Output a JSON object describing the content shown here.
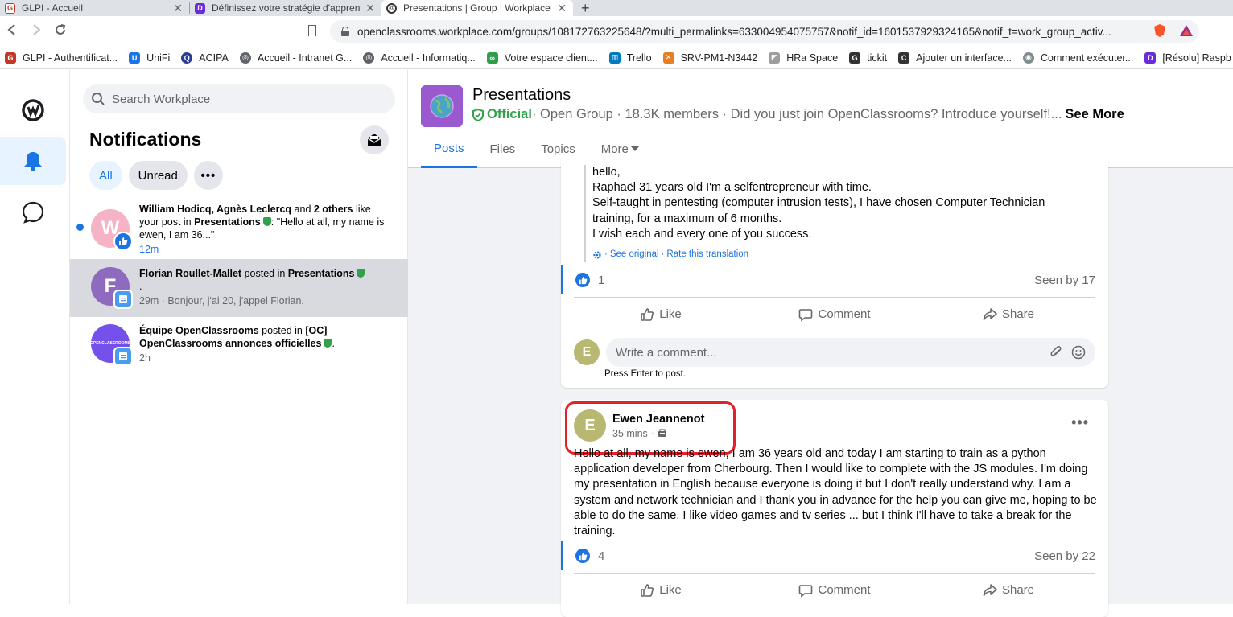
{
  "browser": {
    "tabs": [
      {
        "title": "GLPI - Accueil",
        "active": false
      },
      {
        "title": "Définissez votre stratégie d'apprentissage",
        "active": false
      },
      {
        "title": "Presentations | Group | Workplace",
        "active": true
      }
    ],
    "url": "openclassrooms.workplace.com/groups/108172763225648/?multi_permalinks=633004954075757&notif_id=1601537929324165&notif_t=work_group_activ...",
    "bookmarks": [
      {
        "label": "GLPI - Authentificat...",
        "color": "#c0392b",
        "icon": "G"
      },
      {
        "label": "UniFi",
        "color": "#1a73e8",
        "icon": "U"
      },
      {
        "label": "ACIPA",
        "color": "#2c3e8f",
        "icon": "Q"
      },
      {
        "label": "Accueil - Intranet G...",
        "color": "#5f6368",
        "icon": "◎"
      },
      {
        "label": "Accueil - Informatiq...",
        "color": "#5f6368",
        "icon": "◎"
      },
      {
        "label": "Votre espace client...",
        "color": "#2e9e4a",
        "icon": "∞"
      },
      {
        "label": "Trello",
        "color": "#0079bf",
        "icon": "▥"
      },
      {
        "label": "SRV-PM1-N3442",
        "color": "#e67e22",
        "icon": "✕"
      },
      {
        "label": "HRa Space",
        "color": "#9e9e9e",
        "icon": "◩"
      },
      {
        "label": "tickit",
        "color": "#333333",
        "icon": "G"
      },
      {
        "label": "Ajouter un interface...",
        "color": "#333333",
        "icon": "C"
      },
      {
        "label": "Comment exécuter...",
        "color": "#7f8c8d",
        "icon": "◉"
      },
      {
        "label": "[Résolu] Raspb",
        "color": "#6c2bd9",
        "icon": "D"
      }
    ]
  },
  "sidebar": {
    "search_placeholder": "Search Workplace",
    "title": "Notifications",
    "filters": {
      "all": "All",
      "unread": "Unread",
      "more": "•••"
    }
  },
  "notifications": [
    {
      "avatar_letter": "W",
      "avatar_color": "#f7b3c6",
      "actors": "William Hodicq, Agnès Leclercq",
      "connector": " and ",
      "others": "2 others",
      "action": " like your post in ",
      "group": "Presentations",
      "quote": ": \"Hello at all, my name is ewen, I am 36...\"",
      "time": "12m"
    },
    {
      "avatar_letter": "F",
      "avatar_color": "#8e6bbf",
      "actor": "Florian Roullet-Mallet",
      "action": " posted in ",
      "group": "Presentations",
      "dot": ".",
      "time": "29m",
      "snippet": " · Bonjour, j'ai 20, j'appel Florian."
    },
    {
      "avatar_letter": "OPENCLASSROOMS",
      "avatar_color": "#7451eb",
      "actor": "Équipe OpenClassrooms",
      "action": " posted in ",
      "group": "[OC] OpenClassrooms annonces officielles",
      "tail": ".",
      "time": "2h"
    }
  ],
  "group": {
    "name": "Presentations",
    "official": "Official",
    "meta": " · Open Group · 18.3K members · Did you just join OpenClassrooms? Introduce yourself!...",
    "see_more": "See More",
    "tabs": [
      "Posts",
      "Files",
      "Topics",
      "More"
    ]
  },
  "post1": {
    "lines": [
      "hello,",
      "Raphaël 31 years old I'm a selfentrepreneur with time.",
      "Self-taught in pentesting (computer intrusion tests), I have chosen Computer Technician training, for a maximum of 6 months.",
      "I wish each and every one of you success."
    ],
    "see_original": "See original",
    "rate": "Rate this translation",
    "likes": "1",
    "seen": "Seen by 17",
    "like_label": "Like",
    "comment_label": "Comment",
    "share_label": "Share",
    "comment_placeholder": "Write a comment...",
    "commenter_initial": "E",
    "hint": "Press Enter to post."
  },
  "post2": {
    "author": "Ewen Jeannenot",
    "author_initial": "E",
    "time": "35 mins",
    "text": "Hello at all, my name is ewen, I am 36 years old and today I am starting to train as a python application developer from Cherbourg. Then I would like to complete with the JS modules. I'm doing my presentation in English because everyone is doing it but I don't really understand why. I am a system and network technician and I thank you in advance for the help you can give me, hoping to be able to do the same. I like video games and tv series ... but I think I'll have to take a break for the training.",
    "likes": "4",
    "seen": "Seen by 22",
    "like_label": "Like",
    "comment_label": "Comment",
    "share_label": "Share"
  },
  "colors": {
    "accent": "#1b74e4",
    "official": "#31a24c",
    "highlight": "#e0202a"
  }
}
